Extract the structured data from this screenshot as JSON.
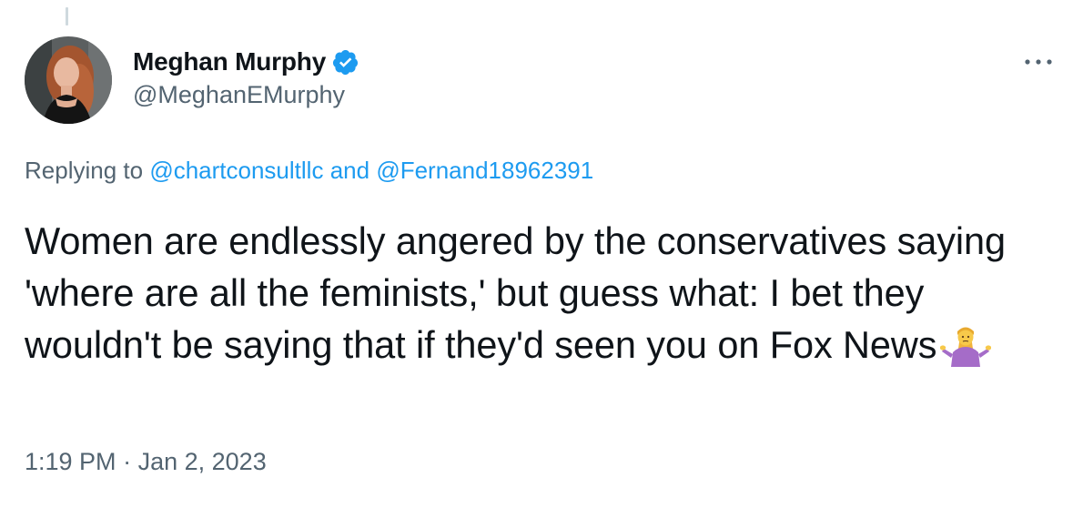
{
  "tweet": {
    "author": {
      "display_name": "Meghan Murphy",
      "handle": "@MeghanEMurphy",
      "verified": true,
      "verified_icon": "verified-badge-icon",
      "verified_color": "#1d9bf0"
    },
    "more_icon": "more-options-icon",
    "reply_context": {
      "prefix": "Replying to",
      "mention_1": "@chartconsultllc",
      "conjunction": "and",
      "mention_2": "@Fernand18962391"
    },
    "text": "Women are endlessly angered by the conservatives saying 'where are all the feminists,' but guess what: I bet they wouldn't be saying that if they'd seen you on Fox News",
    "emoji": "person-shrugging-emoji",
    "time": "1:19 PM",
    "separator": "·",
    "date": "Jan 2, 2023"
  },
  "colors": {
    "text": "#0f1419",
    "secondary": "#536471",
    "link": "#1d9bf0",
    "thread_line": "#cfd9de"
  }
}
